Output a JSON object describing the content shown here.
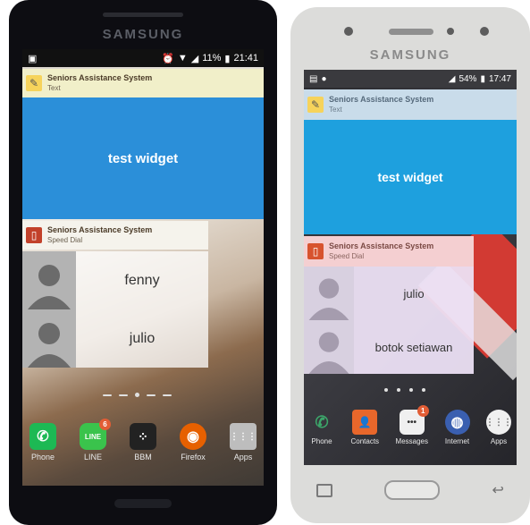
{
  "left_phone": {
    "brand": "SAMSUNG",
    "status": {
      "time": "21:41",
      "battery": "11%"
    },
    "widget_text": {
      "title": "Seniors Assistance System",
      "subtitle": "Text",
      "body": "test widget"
    },
    "widget_dial": {
      "title": "Seniors Assistance System",
      "subtitle": "Speed Dial",
      "contacts": [
        "fenny",
        "julio"
      ]
    },
    "dock": [
      {
        "label": "Phone",
        "icon": "phone-icon",
        "color": "#1db954",
        "glyph": "✆"
      },
      {
        "label": "LINE",
        "icon": "line-icon",
        "color": "#3ac34c",
        "glyph": "LINE",
        "badge": "6"
      },
      {
        "label": "BBM",
        "icon": "bbm-icon",
        "color": "#222222",
        "glyph": "⁘"
      },
      {
        "label": "Firefox",
        "icon": "firefox-icon",
        "color": "#e66000",
        "glyph": "◉"
      },
      {
        "label": "Apps",
        "icon": "apps-grid-icon",
        "color": "#bdbdbd",
        "glyph": "⋮⋮⋮"
      }
    ]
  },
  "right_phone": {
    "brand": "SAMSUNG",
    "status": {
      "time": "17:47",
      "battery": "54%"
    },
    "widget_text": {
      "title": "Seniors Assistance System",
      "subtitle": "Text",
      "body": "test widget"
    },
    "widget_dial": {
      "title": "Seniors Assistance System",
      "subtitle": "Speed Dial",
      "contacts": [
        "julio",
        "botok setiawan"
      ]
    },
    "dock": [
      {
        "label": "Phone",
        "icon": "phone-icon",
        "color": "#2c6e49",
        "glyph": "✆"
      },
      {
        "label": "Contacts",
        "icon": "contacts-icon",
        "color": "#e8672b",
        "glyph": "👤"
      },
      {
        "label": "Messages",
        "icon": "messages-icon",
        "color": "#f0f0f0",
        "glyph": "•••",
        "badge": "1"
      },
      {
        "label": "Internet",
        "icon": "internet-icon",
        "color": "#3a5fb0",
        "glyph": "◍"
      },
      {
        "label": "Apps",
        "icon": "apps-grid-icon",
        "color": "#f0f0f0",
        "glyph": "⋮⋮⋮"
      }
    ]
  }
}
